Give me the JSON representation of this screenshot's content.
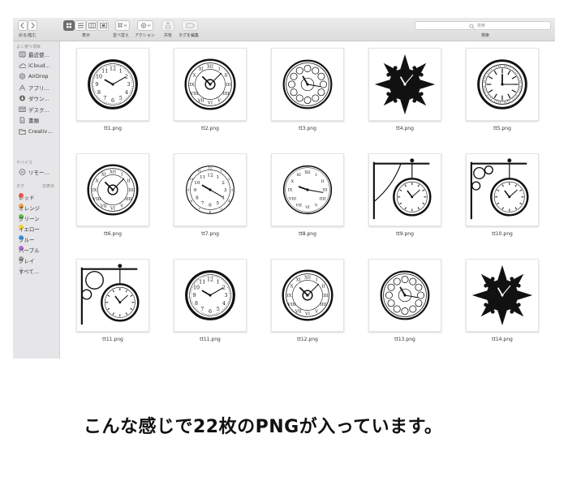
{
  "toolbar": {
    "back_forward_label": "戻る/進む",
    "view_label": "表示",
    "arrange_label": "並べ替え",
    "action_label": "アクション",
    "share_label": "共有",
    "tags_label": "タグを編集",
    "search_placeholder": "検索",
    "search_label": "検索"
  },
  "sidebar": {
    "favorites_header": "よく使う項目",
    "favorites": [
      {
        "label": "最近使…",
        "icon": "recents-icon"
      },
      {
        "label": "iCloud…",
        "icon": "cloud-icon"
      },
      {
        "label": "AirDrop",
        "icon": "airdrop-icon"
      },
      {
        "label": "アプリ…",
        "icon": "applications-icon"
      },
      {
        "label": "ダウン…",
        "icon": "downloads-icon"
      },
      {
        "label": "デスク…",
        "icon": "desktop-icon"
      },
      {
        "label": "書類",
        "icon": "documents-icon"
      },
      {
        "label": "Creativ…",
        "icon": "folder-icon"
      }
    ],
    "devices_header": "デバイス",
    "devices": [
      {
        "label": "リモー…",
        "icon": "remote-disc-icon"
      }
    ],
    "tags_header": "タグ",
    "tags_toggle": "非表示",
    "tags": [
      {
        "label": "レッド",
        "color": "#f2514b"
      },
      {
        "label": "オレンジ",
        "color": "#f7a23a"
      },
      {
        "label": "グリーン",
        "color": "#5cc144"
      },
      {
        "label": "イエロー",
        "color": "#f6d32e"
      },
      {
        "label": "ブルー",
        "color": "#3b9ff0"
      },
      {
        "label": "パープル",
        "color": "#b569d6"
      },
      {
        "label": "グレイ",
        "color": "#9a9a9a"
      },
      {
        "label": "すべて…",
        "color": "#d8d8d8"
      }
    ]
  },
  "files": [
    {
      "name": "tt1.png",
      "style": "classic-arabic"
    },
    {
      "name": "tt2.png",
      "style": "roman-ornate"
    },
    {
      "name": "tt3.png",
      "style": "scalloped"
    },
    {
      "name": "tt4.png",
      "style": "sunburst"
    },
    {
      "name": "tt5.png",
      "style": "double-ring"
    },
    {
      "name": "tt6.png",
      "style": "roman-ornate"
    },
    {
      "name": "tt7.png",
      "style": "double-arabic"
    },
    {
      "name": "tt8.png",
      "style": "roman-plain"
    },
    {
      "name": "tt9.png",
      "style": "bracket-pocket"
    },
    {
      "name": "tt10.png",
      "style": "bracket-scroll"
    },
    {
      "name": "tt11.png",
      "style": "bracket-ornate"
    },
    {
      "name": "tt11.png",
      "style": "classic-arabic"
    },
    {
      "name": "tt12.png",
      "style": "roman-ornate"
    },
    {
      "name": "tt13.png",
      "style": "scalloped"
    },
    {
      "name": "tt14.png",
      "style": "sunburst"
    }
  ],
  "caption": "こんな感じで22枚のPNGが入っています。"
}
